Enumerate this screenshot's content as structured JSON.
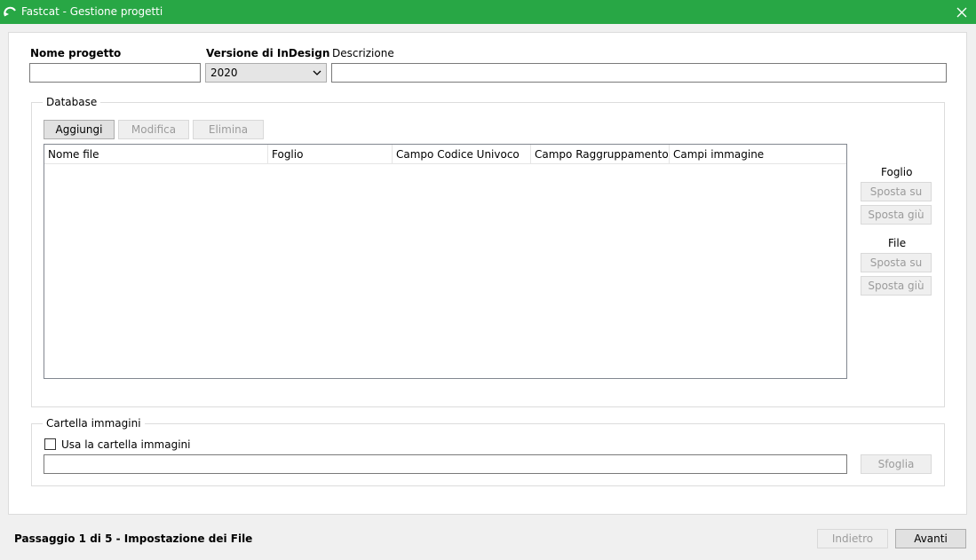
{
  "window": {
    "title": "Fastcat - Gestione progetti",
    "titlebar_color": "#28a745"
  },
  "form": {
    "project_name_label": "Nome progetto",
    "project_name_value": "",
    "indesign_version_label": "Versione di InDesign",
    "indesign_version_value": "2020",
    "description_label": "Descrizione",
    "description_value": ""
  },
  "database": {
    "group_title": "Database",
    "add_label": "Aggiungi",
    "edit_label": "Modifica",
    "delete_label": "Elimina",
    "columns": [
      "Nome file",
      "Foglio",
      "Campo Codice Univoco",
      "Campo Raggruppamento",
      "Campi immagine"
    ],
    "rows": [],
    "sheet_section_label": "Foglio",
    "sheet_move_up_label": "Sposta su",
    "sheet_move_down_label": "Sposta giù",
    "file_section_label": "File",
    "file_move_up_label": "Sposta su",
    "file_move_down_label": "Sposta giù"
  },
  "images_folder": {
    "group_title": "Cartella immagini",
    "use_folder_label": "Usa la cartella immagini",
    "use_folder_checked": false,
    "path_value": "",
    "browse_label": "Sfoglia"
  },
  "footer": {
    "step_label": "Passaggio 1 di 5 - Impostazione dei File",
    "back_label": "Indietro",
    "next_label": "Avanti"
  }
}
